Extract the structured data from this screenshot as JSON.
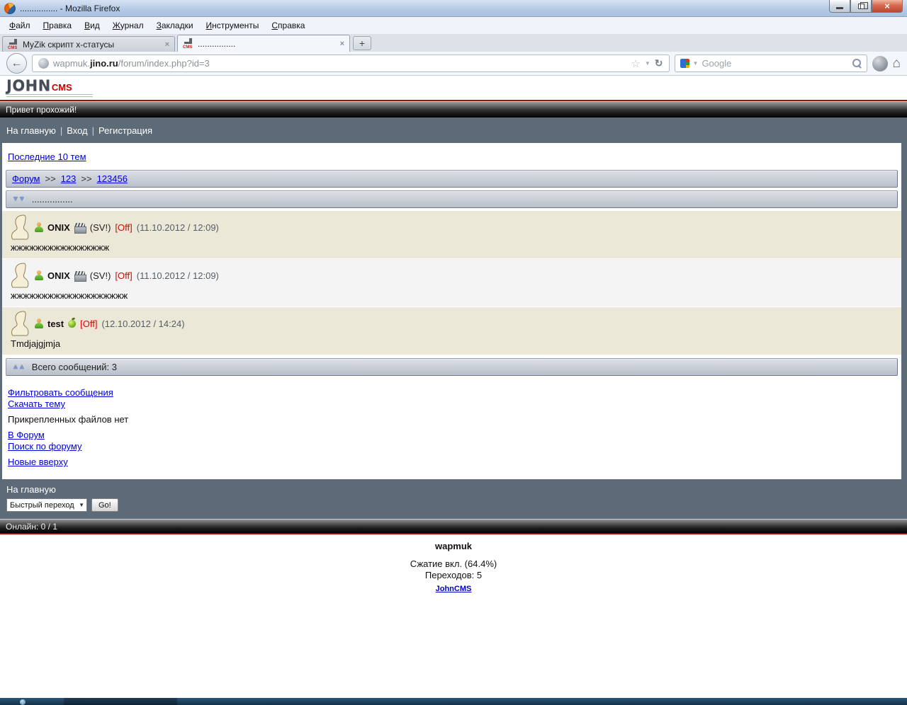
{
  "window": {
    "title": "................ - Mozilla Firefox",
    "minimize": "",
    "restore": "",
    "close": "×"
  },
  "menu": {
    "items": [
      "Файл",
      "Правка",
      "Вид",
      "Журнал",
      "Закладки",
      "Инструменты",
      "Справка"
    ]
  },
  "tabs": {
    "tab1_label": "MyZik скрипт x-статусы",
    "tab2_label": "................",
    "close_glyph": "×",
    "new_tab_glyph": "+"
  },
  "navbar": {
    "back_glyph": "←",
    "url_sub": "wapmuk.",
    "url_domain": "jino.ru",
    "url_path": "/forum/index.php?id=3",
    "star_glyph": "☆",
    "drop_glyph": "▼",
    "reload_glyph": "↻",
    "search_placeholder": "Google",
    "home_glyph": "⌂"
  },
  "branding": {
    "john": "JOHN",
    "cms": "CMS"
  },
  "header": {
    "greeting": "Привет прохожий!",
    "nav": [
      "На главную",
      "Вход",
      "Регистрация"
    ],
    "separator": "|"
  },
  "icons": {
    "down_arrows": "▼▼",
    "up_arrows": "▲▲"
  },
  "page": {
    "last_topics_link": "Последние 10 тем",
    "breadcrumb": {
      "forum": "Форум",
      "sep": ">>",
      "category": "123",
      "topic": "123456"
    },
    "topic_title": "................",
    "posts": [
      {
        "author": "ONIX",
        "xstatus": "(SV!)",
        "off": "[Off]",
        "date": "(11.10.2012 / 12:09)",
        "message": "жжжжжжжжжжжжжжжж"
      },
      {
        "author": "ONIX",
        "xstatus": "(SV!)",
        "off": "[Off]",
        "date": "(11.10.2012 / 12:09)",
        "message": "жжжжжжжжжжжжжжжжжжж"
      },
      {
        "author": "test",
        "xstatus": "",
        "off": "[Off]",
        "date": "(12.10.2012 / 14:24)",
        "message": "Tmdjajgjmja"
      }
    ],
    "total_label": "Всего сообщений: 3",
    "links": {
      "filter": "Фильтровать сообщения",
      "download": "Скачать тему",
      "no_files": "Прикрепленных файлов нет",
      "to_forum": "В Форум",
      "search_forum": "Поиск по форуму",
      "new_on_top": "Новые вверху"
    },
    "bottom": {
      "home_link": "На главную",
      "quick_jump": "Быстрый переход",
      "go_label": "Go!",
      "online": "Онлайн: 0 / 1"
    },
    "footer": {
      "site_name": "wapmuk",
      "compression": "Сжатие вкл. (64.4%)",
      "hits": "Переходов: 5",
      "engine_link": "JohnCMS"
    }
  },
  "colors": {
    "accent_red": "#b00000",
    "link_blue": "#0000dd",
    "off_red": "#e60000",
    "slate": "#5d6a78",
    "post_beige": "#ebe8d7",
    "post_light": "#f4f4f4"
  }
}
